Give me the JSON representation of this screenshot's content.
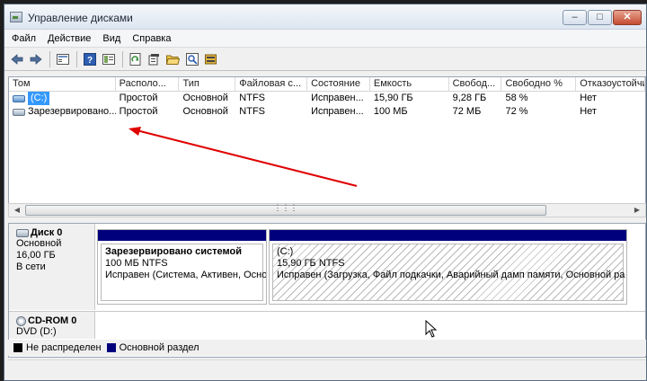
{
  "window": {
    "title": "Управление дисками",
    "buttons": [
      "–",
      "□",
      "✕"
    ]
  },
  "menu": [
    "Файл",
    "Действие",
    "Вид",
    "Справка"
  ],
  "toolbar": {
    "icons": [
      "back-arrow-icon",
      "forward-arrow-icon",
      "list-view-icon",
      "help-icon",
      "properties-icon",
      "refresh-icon",
      "rescan-icon",
      "open-folder-icon",
      "search-icon",
      "settings-icon"
    ]
  },
  "volume_list": {
    "columns": [
      "Том",
      "Располо...",
      "Тип",
      "Файловая с...",
      "Состояние",
      "Емкость",
      "Свобод...",
      "Свободно %",
      "Отказоустойчиво"
    ],
    "rows": [
      [
        "(C:)",
        "Простой",
        "Основной",
        "NTFS",
        "Исправен...",
        "15,90 ГБ",
        "9,28 ГБ",
        "58 %",
        "Нет"
      ],
      [
        "Зарезервировано...",
        "Простой",
        "Основной",
        "NTFS",
        "Исправен...",
        "100 МБ",
        "72 МБ",
        "72 %",
        "Нет"
      ]
    ]
  },
  "disks": [
    {
      "title": "Диск 0",
      "lines": [
        "Основной",
        "16,00 ГБ",
        "В сети"
      ],
      "partitions": [
        {
          "name": "Зарезервировано системой",
          "size": "100 МБ NTFS",
          "status": "Исправен (Система, Активен, Осно"
        },
        {
          "name": "(C:)",
          "size": "15,90 ГБ NTFS",
          "status": "Исправен (Загрузка, Файл подкачки, Аварийный дамп памяти, Основной ра"
        }
      ]
    },
    {
      "title": "CD-ROM 0",
      "lines": [
        "DVD (D:)"
      ]
    }
  ],
  "legend": [
    {
      "label": "Не распределен",
      "color": "#000000"
    },
    {
      "label": "Основной раздел",
      "color": "#00007d"
    }
  ],
  "annotation": {
    "arrow_color": "#e00000"
  }
}
